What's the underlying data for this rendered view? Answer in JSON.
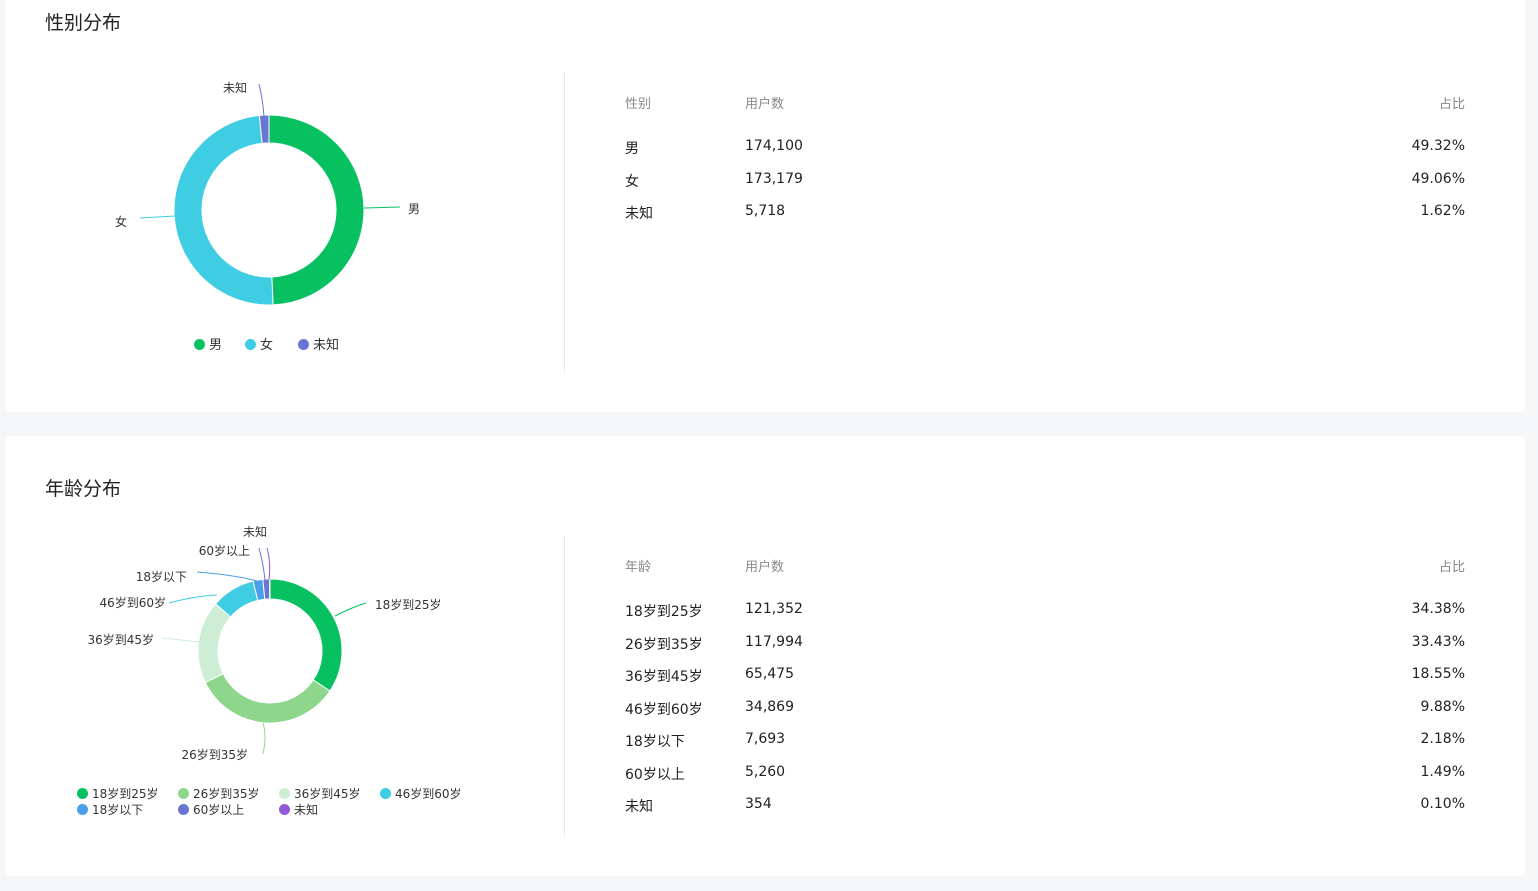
{
  "gender_section": {
    "title": "性别分布",
    "table": {
      "headers": [
        "性别",
        "用户数",
        "占比"
      ],
      "rows": [
        {
          "label": "男",
          "count": "174,100",
          "pct": "49.32%"
        },
        {
          "label": "女",
          "count": "173,179",
          "pct": "49.06%"
        },
        {
          "label": "未知",
          "count": "5,718",
          "pct": "1.62%"
        }
      ]
    }
  },
  "age_section": {
    "title": "年龄分布",
    "table": {
      "headers": [
        "年龄",
        "用户数",
        "占比"
      ],
      "rows": [
        {
          "label": "18岁到25岁",
          "count": "121,352",
          "pct": "34.38%"
        },
        {
          "label": "26岁到35岁",
          "count": "117,994",
          "pct": "33.43%"
        },
        {
          "label": "36岁到45岁",
          "count": "65,475",
          "pct": "18.55%"
        },
        {
          "label": "46岁到60岁",
          "count": "34,869",
          "pct": "9.88%"
        },
        {
          "label": "18岁以下",
          "count": "7,693",
          "pct": "2.18%"
        },
        {
          "label": "60岁以上",
          "count": "5,260",
          "pct": "1.49%"
        },
        {
          "label": "未知",
          "count": "354",
          "pct": "0.10%"
        }
      ]
    }
  },
  "chart_data": [
    {
      "type": "pie",
      "title": "性别分布",
      "categories": [
        "男",
        "女",
        "未知"
      ],
      "values": [
        174100,
        173179,
        5718
      ],
      "colors": [
        "#07c160",
        "#3fcde3",
        "#6a75d3"
      ],
      "legend": "bottom"
    },
    {
      "type": "pie",
      "title": "年龄分布",
      "categories": [
        "18岁到25岁",
        "26岁到35岁",
        "36岁到45岁",
        "46岁到60岁",
        "18岁以下",
        "60岁以上",
        "未知"
      ],
      "values": [
        121352,
        117994,
        65475,
        34869,
        7693,
        5260,
        354
      ],
      "colors": [
        "#07c160",
        "#8dd68b",
        "#cdeed4",
        "#3fcde3",
        "#4a9ee9",
        "#6a75d3",
        "#9358d8"
      ],
      "legend": "bottom"
    }
  ]
}
